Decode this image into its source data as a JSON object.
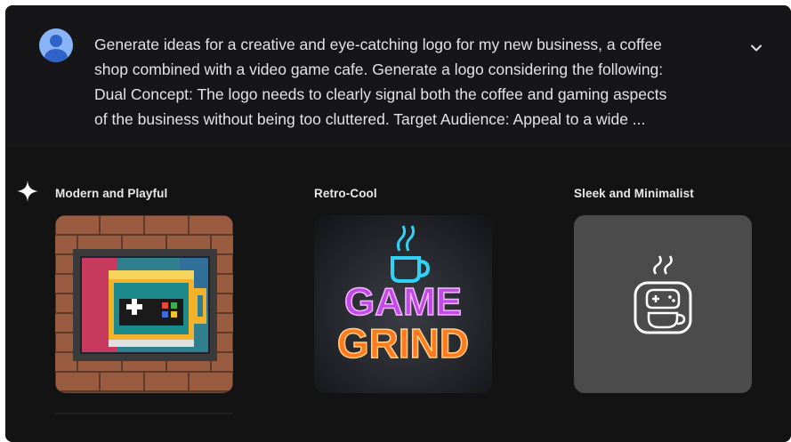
{
  "prompt": {
    "lines": [
      "Generate ideas for a creative and eye-catching logo for my new business, a coffee",
      "shop combined with a video game cafe. Generate a logo considering the following:",
      "Dual Concept: The logo needs to clearly signal both the coffee and gaming aspects",
      "of the business without being too cluttered. Target Audience: Appeal to a wide ..."
    ]
  },
  "options": [
    {
      "title": "Modern and Playful",
      "image": "pixel-art-coffee-gamepad-mug"
    },
    {
      "title": "Retro-Cool",
      "image": "neon-game-grind-sign",
      "neon_text": [
        "GAME",
        "GRIND"
      ]
    },
    {
      "title": "Sleek and Minimalist",
      "image": "minimal-mug-gamepad-icon"
    }
  ],
  "colors": {
    "background": "#131314",
    "prompt_background": "#161618",
    "text": "#e3e3e3",
    "avatar": "#8ab4f8"
  },
  "icons": [
    "user-avatar-icon",
    "chevron-down-icon",
    "sparkle-icon"
  ]
}
